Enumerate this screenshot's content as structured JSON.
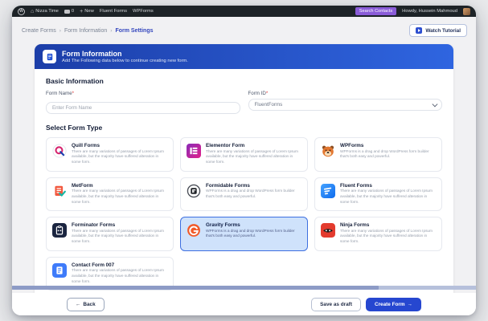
{
  "admin_bar": {
    "wp_logo": "W",
    "site_name": "Nizza Time",
    "comments_count": "0",
    "new_label": "New",
    "menu_items": [
      "Fluent Forms",
      "WPForms"
    ],
    "search_button": "Search Contacts",
    "greeting": "Howdy, Hussein Mahmoud"
  },
  "breadcrumb": {
    "items": [
      "Create Forms",
      "Form Information",
      "Form Settings"
    ],
    "separator": "›"
  },
  "watch_tutorial": {
    "label": "Watch Tutorial"
  },
  "panel": {
    "title": "Form Information",
    "subtitle": "Add The Following data below to continue creating new form."
  },
  "basic_info": {
    "heading": "Basic Information",
    "form_name_label": "Form Name",
    "form_id_label": "Form ID",
    "required_mark": "*",
    "form_name_placeholder": "Enter Form Name",
    "form_id_value": "FluentForms"
  },
  "form_type": {
    "heading": "Select Form Type",
    "cards": [
      {
        "name": "Quill Forms",
        "icon": "quill-forms-icon",
        "selected": false,
        "desc": "There are many variations of passages of Lorem Ipsum available, but the majority have suffered alteration in some form."
      },
      {
        "name": "Elementor Form",
        "icon": "elementor-form-icon",
        "selected": false,
        "desc": "There are many variations of passages of Lorem Ipsum available, but the majority have suffered alteration in some form."
      },
      {
        "name": "WPForms",
        "icon": "wpforms-icon",
        "selected": false,
        "desc": "WPForms is a drag and drop WordPress form builder that's both easy and powerful."
      },
      {
        "name": "MetForm",
        "icon": "metform-icon",
        "selected": false,
        "desc": "There are many variations of passages of Lorem Ipsum available, but the majority have suffered alteration in some form."
      },
      {
        "name": "Formidable Forms",
        "icon": "formidable-forms-icon",
        "selected": false,
        "desc": "WPForms is a drag and drop WordPress form builder that's both easy and powerful."
      },
      {
        "name": "Fluent Forms",
        "icon": "fluent-forms-icon",
        "selected": false,
        "desc": "There are many variations of passages of Lorem Ipsum available, but the majority have suffered alteration in some form."
      },
      {
        "name": "Forminator Forms",
        "icon": "forminator-forms-icon",
        "selected": false,
        "desc": "There are many variations of passages of Lorem Ipsum available, but the majority have suffered alteration in some form."
      },
      {
        "name": "Gravity Forms",
        "icon": "gravity-forms-icon",
        "selected": true,
        "desc": "WPForms is a drag and drop WordPress form builder that's both easy and powerful."
      },
      {
        "name": "Ninja Forms",
        "icon": "ninja-forms-icon",
        "selected": false,
        "desc": "There are many variations of passages of Lorem Ipsum available, but the majority have suffered alteration in some form."
      },
      {
        "name": "Contact Form 007",
        "icon": "contact-form-007-icon",
        "selected": false,
        "desc": "There are many variations of passages of Lorem Ipsum available, but the majority have suffered alteration in some form."
      }
    ]
  },
  "footer": {
    "back_arrow": "←",
    "back_label": "Back",
    "save_draft_label": "Save as draft",
    "create_label": "Create Form",
    "create_arrow": "→"
  },
  "colors": {
    "accent": "#2647d0",
    "header_gradient_start": "#1c3ea8",
    "header_gradient_end": "#2f65e0",
    "selected_card_bg": "#cfe2fb",
    "selected_card_border": "#3d6fe0",
    "admin_bar_bg": "#1d2327",
    "search_button_bg": "#8a5cd8",
    "scrollbar_thumb": "#8d9bc6",
    "scrollbar_track": "#b6c0db"
  }
}
